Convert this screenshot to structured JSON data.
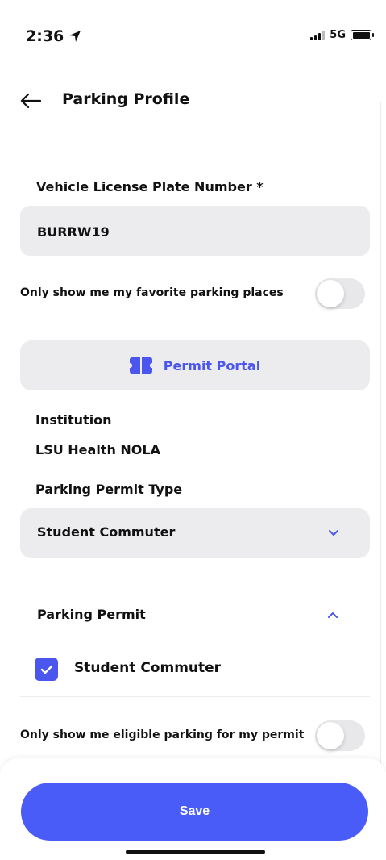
{
  "status_bar": {
    "time": "2:36",
    "network": "5G"
  },
  "header": {
    "title": "Parking Profile"
  },
  "plate": {
    "label": "Vehicle License Plate Number *",
    "value": "BURRW19"
  },
  "favorites_toggle": {
    "label": "Only show me my favorite parking places",
    "on": false
  },
  "permit_portal": {
    "label": "Permit Portal",
    "icon": "ticket-icon"
  },
  "institution": {
    "label": "Institution",
    "value": "LSU Health NOLA"
  },
  "permit_type": {
    "label": "Parking Permit Type",
    "selected": "Student Commuter"
  },
  "parking_permit": {
    "label": "Parking Permit",
    "expanded": true,
    "options": [
      {
        "label": "Student Commuter",
        "checked": true
      }
    ]
  },
  "eligible_toggle": {
    "label": "Only show me eligible parking for my permit",
    "on": false
  },
  "save": {
    "label": "Save"
  },
  "colors": {
    "accent": "#4a56ee",
    "save_button": "#4a5cf7",
    "field_bg": "#ececef"
  }
}
